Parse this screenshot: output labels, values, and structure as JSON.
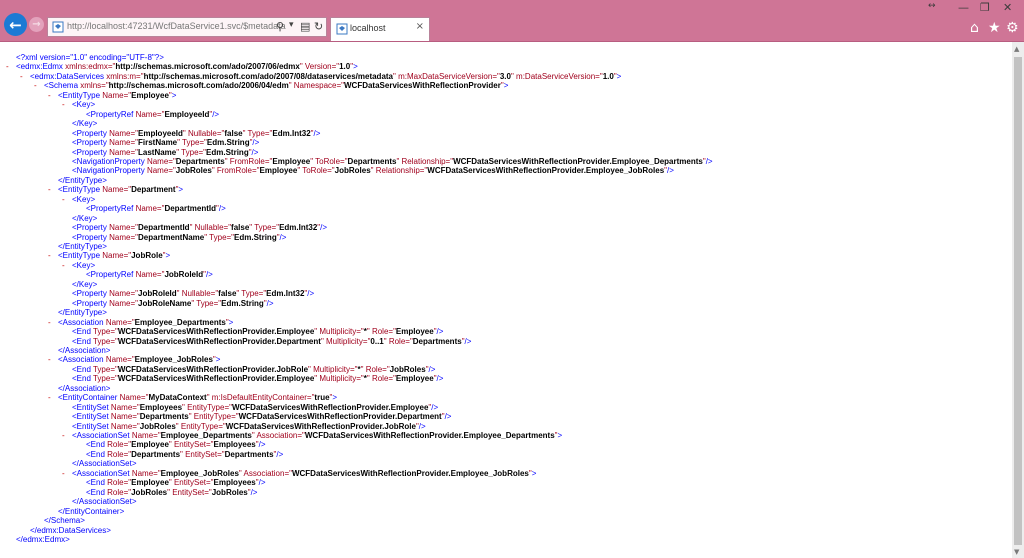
{
  "browser": {
    "address_url": "http://localhost:47231/WcfDataService1.svc/$metadata",
    "tab_title": "localhost",
    "icons": [
      "back-arrow-icon",
      "forward-arrow-icon",
      "page-icon",
      "search-icon",
      "compatibility-icon",
      "refresh-icon",
      "close-icon",
      "minimize-icon",
      "restore-icon",
      "home-icon",
      "favorites-star-icon",
      "settings-gear-icon"
    ]
  },
  "colors": {
    "chrome": "#cf7596",
    "back_button": "#1c7ad4",
    "xml_markup": "#0000ff",
    "xml_attribute_name": "#a0001c",
    "xml_attribute_value": "#000000",
    "xml_toggle": "#c40000"
  },
  "xml_lines": [
    {
      "toggle": "",
      "segs": [
        [
          "p",
          "<?xml version=\"1.0\" encoding=\"UTF-8\"?>"
        ]
      ]
    },
    {
      "toggle": "-",
      "segs": [
        [
          "b",
          "<edmx:Edmx "
        ],
        [
          "n",
          "xmlns:edmx=\""
        ],
        [
          "v",
          "http://schemas.microsoft.com/ado/2007/06/edmx"
        ],
        [
          "n",
          "\" Version=\""
        ],
        [
          "v",
          "1.0"
        ],
        [
          "n",
          "\""
        ],
        [
          "b",
          ">"
        ]
      ]
    },
    {
      "toggle": "-",
      "segs": [
        [
          "b",
          "<edmx:DataServices "
        ],
        [
          "n",
          "xmlns:m=\""
        ],
        [
          "v",
          "http://schemas.microsoft.com/ado/2007/08/dataservices/metadata"
        ],
        [
          "n",
          "\" m:MaxDataServiceVersion=\""
        ],
        [
          "v",
          "3.0"
        ],
        [
          "n",
          "\" m:DataServiceVersion=\""
        ],
        [
          "v",
          "1.0"
        ],
        [
          "n",
          "\""
        ],
        [
          "b",
          ">"
        ]
      ]
    },
    {
      "toggle": "-",
      "segs": [
        [
          "b",
          "<Schema "
        ],
        [
          "n",
          "xmlns=\""
        ],
        [
          "v",
          "http://schemas.microsoft.com/ado/2006/04/edm"
        ],
        [
          "n",
          "\" Namespace=\""
        ],
        [
          "v",
          "WCFDataServicesWithReflectionProvider"
        ],
        [
          "n",
          "\""
        ],
        [
          "b",
          ">"
        ]
      ]
    },
    {
      "toggle": "-",
      "segs": [
        [
          "b",
          "<EntityType "
        ],
        [
          "n",
          "Name=\""
        ],
        [
          "v",
          "Employee"
        ],
        [
          "n",
          "\""
        ],
        [
          "b",
          ">"
        ]
      ]
    },
    {
      "toggle": "-",
      "segs": [
        [
          "b",
          "<Key>"
        ]
      ]
    },
    {
      "toggle": "",
      "segs": [
        [
          "b",
          "<PropertyRef "
        ],
        [
          "n",
          "Name=\""
        ],
        [
          "v",
          "EmployeeId"
        ],
        [
          "n",
          "\""
        ],
        [
          "b",
          "/>"
        ]
      ]
    },
    {
      "toggle": "",
      "segs": [
        [
          "b",
          "</Key>"
        ]
      ]
    },
    {
      "toggle": "",
      "segs": [
        [
          "b",
          "<Property "
        ],
        [
          "n",
          "Name=\""
        ],
        [
          "v",
          "EmployeeId"
        ],
        [
          "n",
          "\" Nullable=\""
        ],
        [
          "v",
          "false"
        ],
        [
          "n",
          "\" Type=\""
        ],
        [
          "v",
          "Edm.Int32"
        ],
        [
          "n",
          "\""
        ],
        [
          "b",
          "/>"
        ]
      ]
    },
    {
      "toggle": "",
      "segs": [
        [
          "b",
          "<Property "
        ],
        [
          "n",
          "Name=\""
        ],
        [
          "v",
          "FirstName"
        ],
        [
          "n",
          "\" Type=\""
        ],
        [
          "v",
          "Edm.String"
        ],
        [
          "n",
          "\""
        ],
        [
          "b",
          "/>"
        ]
      ]
    },
    {
      "toggle": "",
      "segs": [
        [
          "b",
          "<Property "
        ],
        [
          "n",
          "Name=\""
        ],
        [
          "v",
          "LastName"
        ],
        [
          "n",
          "\" Type=\""
        ],
        [
          "v",
          "Edm.String"
        ],
        [
          "n",
          "\""
        ],
        [
          "b",
          "/>"
        ]
      ]
    },
    {
      "toggle": "",
      "segs": [
        [
          "b",
          "<NavigationProperty "
        ],
        [
          "n",
          "Name=\""
        ],
        [
          "v",
          "Departments"
        ],
        [
          "n",
          "\" FromRole=\""
        ],
        [
          "v",
          "Employee"
        ],
        [
          "n",
          "\" ToRole=\""
        ],
        [
          "v",
          "Departments"
        ],
        [
          "n",
          "\" Relationship=\""
        ],
        [
          "v",
          "WCFDataServicesWithReflectionProvider.Employee_Departments"
        ],
        [
          "n",
          "\""
        ],
        [
          "b",
          "/>"
        ]
      ]
    },
    {
      "toggle": "",
      "segs": [
        [
          "b",
          "<NavigationProperty "
        ],
        [
          "n",
          "Name=\""
        ],
        [
          "v",
          "JobRoles"
        ],
        [
          "n",
          "\" FromRole=\""
        ],
        [
          "v",
          "Employee"
        ],
        [
          "n",
          "\" ToRole=\""
        ],
        [
          "v",
          "JobRoles"
        ],
        [
          "n",
          "\" Relationship=\""
        ],
        [
          "v",
          "WCFDataServicesWithReflectionProvider.Employee_JobRoles"
        ],
        [
          "n",
          "\""
        ],
        [
          "b",
          "/>"
        ]
      ]
    },
    {
      "toggle": "",
      "segs": [
        [
          "b",
          "</EntityType>"
        ]
      ]
    },
    {
      "toggle": "-",
      "segs": [
        [
          "b",
          "<EntityType "
        ],
        [
          "n",
          "Name=\""
        ],
        [
          "v",
          "Department"
        ],
        [
          "n",
          "\""
        ],
        [
          "b",
          ">"
        ]
      ]
    },
    {
      "toggle": "-",
      "segs": [
        [
          "b",
          "<Key>"
        ]
      ]
    },
    {
      "toggle": "",
      "segs": [
        [
          "b",
          "<PropertyRef "
        ],
        [
          "n",
          "Name=\""
        ],
        [
          "v",
          "DepartmentId"
        ],
        [
          "n",
          "\""
        ],
        [
          "b",
          "/>"
        ]
      ]
    },
    {
      "toggle": "",
      "segs": [
        [
          "b",
          "</Key>"
        ]
      ]
    },
    {
      "toggle": "",
      "segs": [
        [
          "b",
          "<Property "
        ],
        [
          "n",
          "Name=\""
        ],
        [
          "v",
          "DepartmentId"
        ],
        [
          "n",
          "\" Nullable=\""
        ],
        [
          "v",
          "false"
        ],
        [
          "n",
          "\" Type=\""
        ],
        [
          "v",
          "Edm.Int32"
        ],
        [
          "n",
          "\""
        ],
        [
          "b",
          "/>"
        ]
      ]
    },
    {
      "toggle": "",
      "segs": [
        [
          "b",
          "<Property "
        ],
        [
          "n",
          "Name=\""
        ],
        [
          "v",
          "DepartmentName"
        ],
        [
          "n",
          "\" Type=\""
        ],
        [
          "v",
          "Edm.String"
        ],
        [
          "n",
          "\""
        ],
        [
          "b",
          "/>"
        ]
      ]
    },
    {
      "toggle": "",
      "segs": [
        [
          "b",
          "</EntityType>"
        ]
      ]
    },
    {
      "toggle": "-",
      "segs": [
        [
          "b",
          "<EntityType "
        ],
        [
          "n",
          "Name=\""
        ],
        [
          "v",
          "JobRole"
        ],
        [
          "n",
          "\""
        ],
        [
          "b",
          ">"
        ]
      ]
    },
    {
      "toggle": "-",
      "segs": [
        [
          "b",
          "<Key>"
        ]
      ]
    },
    {
      "toggle": "",
      "segs": [
        [
          "b",
          "<PropertyRef "
        ],
        [
          "n",
          "Name=\""
        ],
        [
          "v",
          "JobRoleId"
        ],
        [
          "n",
          "\""
        ],
        [
          "b",
          "/>"
        ]
      ]
    },
    {
      "toggle": "",
      "segs": [
        [
          "b",
          "</Key>"
        ]
      ]
    },
    {
      "toggle": "",
      "segs": [
        [
          "b",
          "<Property "
        ],
        [
          "n",
          "Name=\""
        ],
        [
          "v",
          "JobRoleId"
        ],
        [
          "n",
          "\" Nullable=\""
        ],
        [
          "v",
          "false"
        ],
        [
          "n",
          "\" Type=\""
        ],
        [
          "v",
          "Edm.Int32"
        ],
        [
          "n",
          "\""
        ],
        [
          "b",
          "/>"
        ]
      ]
    },
    {
      "toggle": "",
      "segs": [
        [
          "b",
          "<Property "
        ],
        [
          "n",
          "Name=\""
        ],
        [
          "v",
          "JobRoleName"
        ],
        [
          "n",
          "\" Type=\""
        ],
        [
          "v",
          "Edm.String"
        ],
        [
          "n",
          "\""
        ],
        [
          "b",
          "/>"
        ]
      ]
    },
    {
      "toggle": "",
      "segs": [
        [
          "b",
          "</EntityType>"
        ]
      ]
    },
    {
      "toggle": "-",
      "segs": [
        [
          "b",
          "<Association "
        ],
        [
          "n",
          "Name=\""
        ],
        [
          "v",
          "Employee_Departments"
        ],
        [
          "n",
          "\""
        ],
        [
          "b",
          ">"
        ]
      ]
    },
    {
      "toggle": "",
      "segs": [
        [
          "b",
          "<End "
        ],
        [
          "n",
          "Type=\""
        ],
        [
          "v",
          "WCFDataServicesWithReflectionProvider.Employee"
        ],
        [
          "n",
          "\" Multiplicity=\""
        ],
        [
          "v",
          "*"
        ],
        [
          "n",
          "\" Role=\""
        ],
        [
          "v",
          "Employee"
        ],
        [
          "n",
          "\""
        ],
        [
          "b",
          "/>"
        ]
      ]
    },
    {
      "toggle": "",
      "segs": [
        [
          "b",
          "<End "
        ],
        [
          "n",
          "Type=\""
        ],
        [
          "v",
          "WCFDataServicesWithReflectionProvider.Department"
        ],
        [
          "n",
          "\" Multiplicity=\""
        ],
        [
          "v",
          "0..1"
        ],
        [
          "n",
          "\" Role=\""
        ],
        [
          "v",
          "Departments"
        ],
        [
          "n",
          "\""
        ],
        [
          "b",
          "/>"
        ]
      ]
    },
    {
      "toggle": "",
      "segs": [
        [
          "b",
          "</Association>"
        ]
      ]
    },
    {
      "toggle": "-",
      "segs": [
        [
          "b",
          "<Association "
        ],
        [
          "n",
          "Name=\""
        ],
        [
          "v",
          "Employee_JobRoles"
        ],
        [
          "n",
          "\""
        ],
        [
          "b",
          ">"
        ]
      ]
    },
    {
      "toggle": "",
      "segs": [
        [
          "b",
          "<End "
        ],
        [
          "n",
          "Type=\""
        ],
        [
          "v",
          "WCFDataServicesWithReflectionProvider.JobRole"
        ],
        [
          "n",
          "\" Multiplicity=\""
        ],
        [
          "v",
          "*"
        ],
        [
          "n",
          "\" Role=\""
        ],
        [
          "v",
          "JobRoles"
        ],
        [
          "n",
          "\""
        ],
        [
          "b",
          "/>"
        ]
      ]
    },
    {
      "toggle": "",
      "segs": [
        [
          "b",
          "<End "
        ],
        [
          "n",
          "Type=\""
        ],
        [
          "v",
          "WCFDataServicesWithReflectionProvider.Employee"
        ],
        [
          "n",
          "\" Multiplicity=\""
        ],
        [
          "v",
          "*"
        ],
        [
          "n",
          "\" Role=\""
        ],
        [
          "v",
          "Employee"
        ],
        [
          "n",
          "\""
        ],
        [
          "b",
          "/>"
        ]
      ]
    },
    {
      "toggle": "",
      "segs": [
        [
          "b",
          "</Association>"
        ]
      ]
    },
    {
      "toggle": "-",
      "segs": [
        [
          "b",
          "<EntityContainer "
        ],
        [
          "n",
          "Name=\""
        ],
        [
          "v",
          "MyDataContext"
        ],
        [
          "n",
          "\" m:IsDefaultEntityContainer=\""
        ],
        [
          "v",
          "true"
        ],
        [
          "n",
          "\""
        ],
        [
          "b",
          ">"
        ]
      ]
    },
    {
      "toggle": "",
      "segs": [
        [
          "b",
          "<EntitySet "
        ],
        [
          "n",
          "Name=\""
        ],
        [
          "v",
          "Employees"
        ],
        [
          "n",
          "\" EntityType=\""
        ],
        [
          "v",
          "WCFDataServicesWithReflectionProvider.Employee"
        ],
        [
          "n",
          "\""
        ],
        [
          "b",
          "/>"
        ]
      ]
    },
    {
      "toggle": "",
      "segs": [
        [
          "b",
          "<EntitySet "
        ],
        [
          "n",
          "Name=\""
        ],
        [
          "v",
          "Departments"
        ],
        [
          "n",
          "\" EntityType=\""
        ],
        [
          "v",
          "WCFDataServicesWithReflectionProvider.Department"
        ],
        [
          "n",
          "\""
        ],
        [
          "b",
          "/>"
        ]
      ]
    },
    {
      "toggle": "",
      "segs": [
        [
          "b",
          "<EntitySet "
        ],
        [
          "n",
          "Name=\""
        ],
        [
          "v",
          "JobRoles"
        ],
        [
          "n",
          "\" EntityType=\""
        ],
        [
          "v",
          "WCFDataServicesWithReflectionProvider.JobRole"
        ],
        [
          "n",
          "\""
        ],
        [
          "b",
          "/>"
        ]
      ]
    },
    {
      "toggle": "-",
      "segs": [
        [
          "b",
          "<AssociationSet "
        ],
        [
          "n",
          "Name=\""
        ],
        [
          "v",
          "Employee_Departments"
        ],
        [
          "n",
          "\" Association=\""
        ],
        [
          "v",
          "WCFDataServicesWithReflectionProvider.Employee_Departments"
        ],
        [
          "n",
          "\""
        ],
        [
          "b",
          ">"
        ]
      ]
    },
    {
      "toggle": "",
      "segs": [
        [
          "b",
          "<End "
        ],
        [
          "n",
          "Role=\""
        ],
        [
          "v",
          "Employee"
        ],
        [
          "n",
          "\" EntitySet=\""
        ],
        [
          "v",
          "Employees"
        ],
        [
          "n",
          "\""
        ],
        [
          "b",
          "/>"
        ]
      ]
    },
    {
      "toggle": "",
      "segs": [
        [
          "b",
          "<End "
        ],
        [
          "n",
          "Role=\""
        ],
        [
          "v",
          "Departments"
        ],
        [
          "n",
          "\" EntitySet=\""
        ],
        [
          "v",
          "Departments"
        ],
        [
          "n",
          "\""
        ],
        [
          "b",
          "/>"
        ]
      ]
    },
    {
      "toggle": "",
      "segs": [
        [
          "b",
          "</AssociationSet>"
        ]
      ]
    },
    {
      "toggle": "-",
      "segs": [
        [
          "b",
          "<AssociationSet "
        ],
        [
          "n",
          "Name=\""
        ],
        [
          "v",
          "Employee_JobRoles"
        ],
        [
          "n",
          "\" Association=\""
        ],
        [
          "v",
          "WCFDataServicesWithReflectionProvider.Employee_JobRoles"
        ],
        [
          "n",
          "\""
        ],
        [
          "b",
          ">"
        ]
      ]
    },
    {
      "toggle": "",
      "segs": [
        [
          "b",
          "<End "
        ],
        [
          "n",
          "Role=\""
        ],
        [
          "v",
          "Employee"
        ],
        [
          "n",
          "\" EntitySet=\""
        ],
        [
          "v",
          "Employees"
        ],
        [
          "n",
          "\""
        ],
        [
          "b",
          "/>"
        ]
      ]
    },
    {
      "toggle": "",
      "segs": [
        [
          "b",
          "<End "
        ],
        [
          "n",
          "Role=\""
        ],
        [
          "v",
          "JobRoles"
        ],
        [
          "n",
          "\" EntitySet=\""
        ],
        [
          "v",
          "JobRoles"
        ],
        [
          "n",
          "\""
        ],
        [
          "b",
          "/>"
        ]
      ]
    },
    {
      "toggle": "",
      "segs": [
        [
          "b",
          "</AssociationSet>"
        ]
      ]
    },
    {
      "toggle": "",
      "segs": [
        [
          "b",
          "</EntityContainer>"
        ]
      ]
    },
    {
      "toggle": "",
      "segs": [
        [
          "b",
          "</Schema>"
        ]
      ]
    },
    {
      "toggle": "",
      "segs": [
        [
          "b",
          "</edmx:DataServices>"
        ]
      ]
    },
    {
      "toggle": "",
      "segs": [
        [
          "b",
          "</edmx:Edmx>"
        ]
      ]
    }
  ]
}
